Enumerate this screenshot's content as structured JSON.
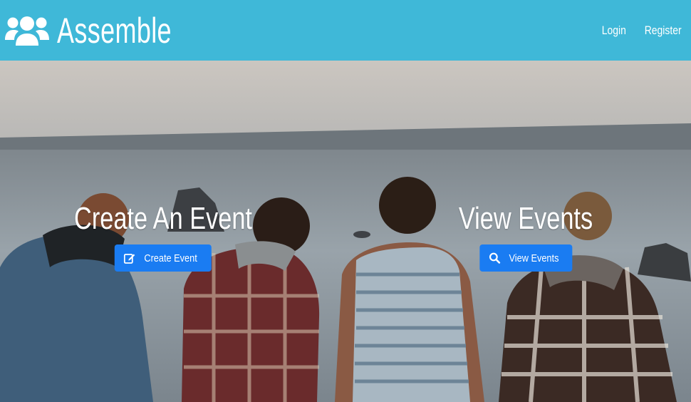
{
  "brand": {
    "name": "Assemble",
    "icon": "users-icon"
  },
  "nav": {
    "login_label": "Login",
    "register_label": "Register"
  },
  "hero": {
    "create": {
      "title": "Create An Event",
      "button_label": "Create Event",
      "button_icon": "edit-icon"
    },
    "view": {
      "title": "View Events",
      "button_label": "View Events",
      "button_icon": "search-icon"
    }
  },
  "colors": {
    "navbar": "#3fb8d8",
    "button": "#1a7cf2",
    "text": "#ffffff"
  }
}
